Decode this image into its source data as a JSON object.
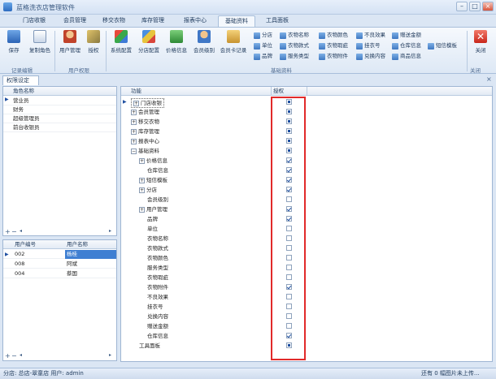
{
  "window": {
    "title": "蓝格洗衣店管理软件",
    "min": "–",
    "max": "□",
    "close": "×"
  },
  "tabs": [
    "门店收银",
    "会员管理",
    "移交衣物",
    "库存管理",
    "报表中心",
    "基础资料",
    "工具面板"
  ],
  "active_tab": 5,
  "ribbon": {
    "record": {
      "save": "保存",
      "copy_role": "复制角色",
      "group": "记录编辑"
    },
    "user": {
      "user_mgmt": "用户管理",
      "auth": "授权",
      "group": "用户权限"
    },
    "basic": {
      "sys_config": "系统配置",
      "branch_config": "分店配置",
      "price_info": "价格信息",
      "member_level": "会员级别",
      "member_card": "会员卡记录",
      "small": [
        "分店",
        "单位",
        "品牌",
        "衣物名称",
        "衣物款式",
        "服务类型",
        "衣物颜色",
        "衣物瑕疵",
        "衣物附件",
        "不良效果",
        "挂衣号",
        "兑换内容",
        "赠送金额",
        "仓库信息",
        "商品信息",
        "短信模板"
      ],
      "group": "基础资料"
    },
    "close": {
      "label": "关闭",
      "group": "关闭"
    }
  },
  "panel_tab": "权限设定",
  "roles": {
    "header": "角色名称",
    "items": [
      "营业员",
      "财务",
      "超级管理员",
      "前台收银员"
    ]
  },
  "users": {
    "col_id": "用户编号",
    "col_name": "用户名称",
    "rows": [
      [
        "002",
        "杨桂"
      ],
      [
        "008",
        "阿斌"
      ],
      [
        "004",
        "蔡国"
      ]
    ],
    "selected": 0
  },
  "tree": {
    "col_func": "功能",
    "col_auth": "授权",
    "rows": [
      {
        "label": "门店收银",
        "indent": 0,
        "exp": "+",
        "state": "part"
      },
      {
        "label": "会员管理",
        "indent": 0,
        "exp": "+",
        "state": "part"
      },
      {
        "label": "移交衣物",
        "indent": 0,
        "exp": "+",
        "state": "part"
      },
      {
        "label": "库存管理",
        "indent": 0,
        "exp": "+",
        "state": "part"
      },
      {
        "label": "报表中心",
        "indent": 0,
        "exp": "+",
        "state": "part"
      },
      {
        "label": "基础资料",
        "indent": 0,
        "exp": "−",
        "state": "part"
      },
      {
        "label": "价格信息",
        "indent": 1,
        "exp": "+",
        "state": "on"
      },
      {
        "label": "仓库信息",
        "indent": 1,
        "exp": "",
        "state": "on"
      },
      {
        "label": "短信模板",
        "indent": 1,
        "exp": "+",
        "state": "on"
      },
      {
        "label": "分店",
        "indent": 1,
        "exp": "+",
        "state": "on"
      },
      {
        "label": "会员级别",
        "indent": 1,
        "exp": "",
        "state": "off"
      },
      {
        "label": "用户管理",
        "indent": 1,
        "exp": "+",
        "state": "on"
      },
      {
        "label": "品牌",
        "indent": 1,
        "exp": "",
        "state": "on"
      },
      {
        "label": "单位",
        "indent": 1,
        "exp": "",
        "state": "off"
      },
      {
        "label": "衣物名称",
        "indent": 1,
        "exp": "",
        "state": "off"
      },
      {
        "label": "衣物款式",
        "indent": 1,
        "exp": "",
        "state": "off"
      },
      {
        "label": "衣物颜色",
        "indent": 1,
        "exp": "",
        "state": "off"
      },
      {
        "label": "服务类型",
        "indent": 1,
        "exp": "",
        "state": "off"
      },
      {
        "label": "衣物瑕疵",
        "indent": 1,
        "exp": "",
        "state": "off"
      },
      {
        "label": "衣物附件",
        "indent": 1,
        "exp": "",
        "state": "on"
      },
      {
        "label": "不良效果",
        "indent": 1,
        "exp": "",
        "state": "off"
      },
      {
        "label": "挂衣号",
        "indent": 1,
        "exp": "",
        "state": "off"
      },
      {
        "label": "兑换内容",
        "indent": 1,
        "exp": "",
        "state": "off"
      },
      {
        "label": "赠送金额",
        "indent": 1,
        "exp": "",
        "state": "off"
      },
      {
        "label": "仓库信息",
        "indent": 1,
        "exp": "",
        "state": "on"
      },
      {
        "label": "工具面板",
        "indent": 0,
        "exp": "",
        "state": "part"
      }
    ]
  },
  "status": {
    "left": "分店: 总店-翠童店  用户: admin",
    "right": "还有 0 幅图片未上传..."
  },
  "colors": {
    "selection": "#3f7fd2",
    "highlight_box": "#e12a2a"
  }
}
